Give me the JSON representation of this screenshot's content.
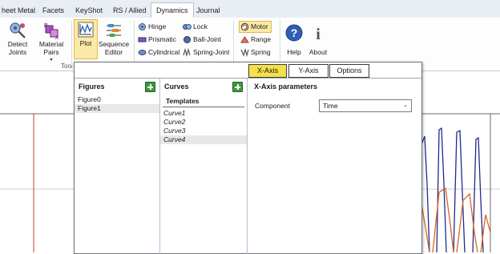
{
  "menu": {
    "tabs": [
      {
        "label": "heet Metal"
      },
      {
        "label": "Facets"
      },
      {
        "label": "KeyShot"
      },
      {
        "label": "RS / Allied"
      },
      {
        "label": "Dynamics",
        "active": true
      },
      {
        "label": "Journal"
      }
    ]
  },
  "ribbon": {
    "detect_joints": "Detect Joints",
    "material_pairs": "Material Pairs",
    "group_label": "Tool",
    "plot": "Plot",
    "sequence_editor": "Sequence Editor",
    "hinge": "Hinge",
    "prismatic": "Prismatic",
    "cylindrical": "Cylindrical",
    "lock": "Lock",
    "ball_joint": "Ball-Joint",
    "spring_joint": "Spring-Joint",
    "motor": "Motor",
    "range": "Range",
    "spring": "Spring",
    "help": "Help",
    "about": "About"
  },
  "dialog": {
    "tabs": [
      {
        "label": "X-Axis",
        "active": true
      },
      {
        "label": "Y-Axis"
      },
      {
        "label": "Options"
      }
    ],
    "figures": {
      "header": "Figures",
      "items": [
        {
          "label": "Figure0"
        },
        {
          "label": "Figure1",
          "selected": true
        }
      ]
    },
    "curves": {
      "header": "Curves",
      "templates_label": "Templates",
      "items": [
        {
          "label": "Curve1"
        },
        {
          "label": "Curve2"
        },
        {
          "label": "Curve3"
        },
        {
          "label": "Curve4",
          "selected": true
        }
      ]
    },
    "params": {
      "header": "X-Axis parameters",
      "component_label": "Component",
      "component_value": "Time"
    }
  },
  "colors": {
    "accent_tab": "#f4e04a",
    "plot_blue": "#1f2b8c",
    "plot_orange": "#d9651f",
    "plot_red": "#c83a3a",
    "add_green": "#3e9a3a"
  }
}
